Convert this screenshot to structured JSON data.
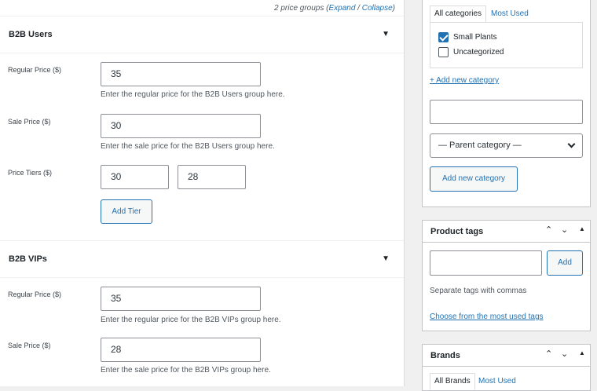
{
  "price_groups": {
    "summary": "2 price groups (",
    "expand_label": "Expand",
    "separator": " / ",
    "collapse_label": "Collapse",
    "suffix": ")"
  },
  "groups": [
    {
      "name": "B2B Users",
      "toggle": "▼",
      "regular_label": "Regular Price ($)",
      "regular_value": "35",
      "regular_desc": "Enter the regular price for the B2B Users group here.",
      "sale_label": "Sale Price ($)",
      "sale_value": "30",
      "sale_desc": "Enter the sale price for the B2B Users group here.",
      "tiers_label": "Price Tiers ($)",
      "tier_values": [
        "30",
        "28"
      ],
      "add_tier_label": "Add Tier"
    },
    {
      "name": "B2B VIPs",
      "toggle": "▼",
      "regular_label": "Regular Price ($)",
      "regular_value": "35",
      "regular_desc": "Enter the regular price for the B2B VIPs group here.",
      "sale_label": "Sale Price ($)",
      "sale_value": "28",
      "sale_desc": "Enter the sale price for the B2B VIPs group here."
    }
  ],
  "categories_box": {
    "tabs": [
      "All categories",
      "Most Used"
    ],
    "items": [
      {
        "label": "Small Plants",
        "checked": true
      },
      {
        "label": "Uncategorized",
        "checked": false
      }
    ],
    "add_new_link": "+ Add new category",
    "new_category_value": "",
    "parent_select": "— Parent category —",
    "add_button": "Add new category"
  },
  "tags_box": {
    "title": "Product tags",
    "input_value": "",
    "add_button": "Add",
    "hint": "Separate tags with commas",
    "choose_link": "Choose from the most used tags"
  },
  "brands_box": {
    "title": "Brands",
    "tabs": [
      "All Brands",
      "Most Used"
    ]
  },
  "colors": {
    "accent": "#2271b1",
    "border": "#c3c4c7",
    "background": "#f0f0f1"
  }
}
